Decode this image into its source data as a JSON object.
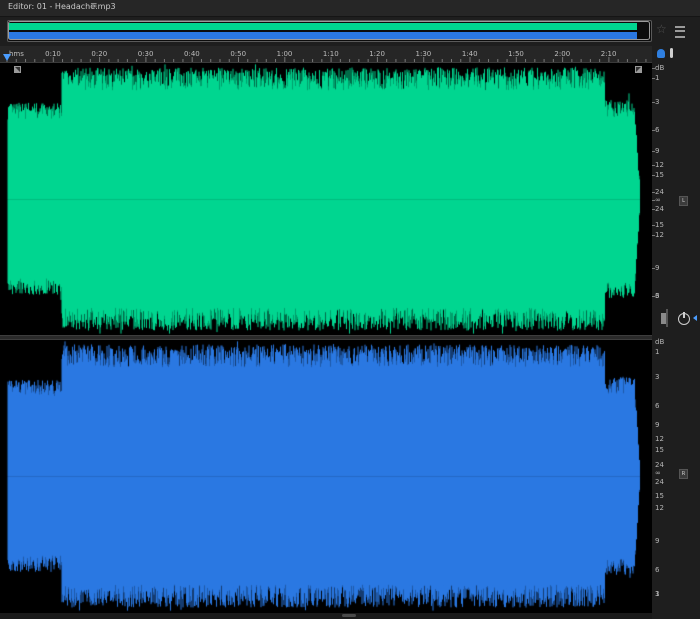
{
  "title_bar": {
    "title": "Editor: 01 - Headache.mp3",
    "menu_icon": "hamburger-menu-icon"
  },
  "ruler": {
    "unit": "hms",
    "ticks": [
      "0:10",
      "0:20",
      "0:30",
      "0:40",
      "0:50",
      "1:00",
      "1:10",
      "1:20",
      "1:30",
      "1:40",
      "1:50",
      "2:00",
      "2:10"
    ]
  },
  "channels": [
    {
      "id": "L",
      "color": "#00d690",
      "badge": "L",
      "db_labels": [
        "dB",
        "1",
        "3",
        "6",
        "9",
        "12",
        "15",
        "24",
        "∞",
        "24",
        "15",
        "12",
        "9",
        "6",
        "3"
      ]
    },
    {
      "id": "R",
      "color": "#2a78e2",
      "badge": "R",
      "db_labels": [
        "dB",
        "1",
        "3",
        "6",
        "9",
        "12",
        "15",
        "24",
        "∞",
        "24",
        "15",
        "12",
        "9",
        "6",
        "3",
        "1"
      ]
    }
  ],
  "colors": {
    "left_wave": "#00d690",
    "right_wave": "#2a78e2",
    "background": "#000000",
    "accent": "#4b9dff"
  },
  "icons": {
    "zoom": "star-icon",
    "panel": "panel-layout-icon",
    "snap": "snap-magnet-icon",
    "pin": "pin-icon",
    "volume": "volume-knob-icon",
    "playhead": "playhead-icon"
  }
}
